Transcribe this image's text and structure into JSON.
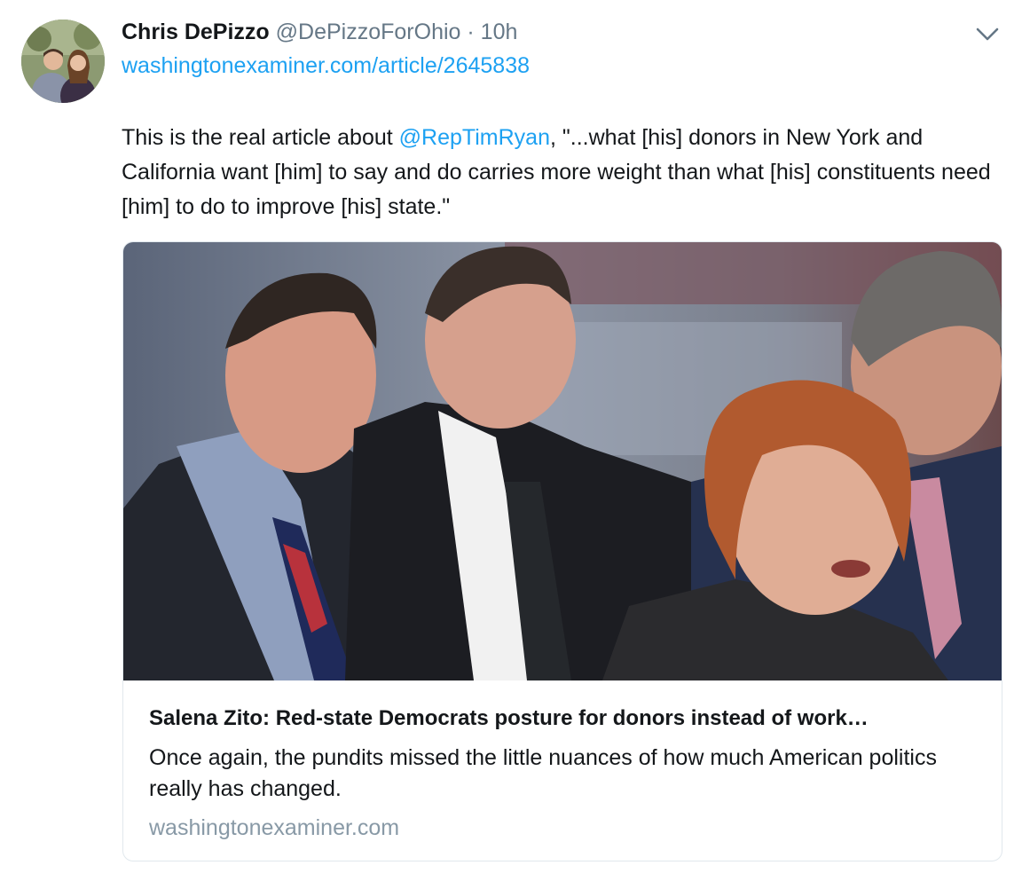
{
  "tweet": {
    "author_name": "Chris DePizzo",
    "author_handle": "@DePizzoForOhio",
    "separator": "·",
    "time": "10h",
    "link": "washingtonexaminer.com/article/2645838",
    "text_before": "This is the real article about ",
    "mention": "@RepTimRyan",
    "text_after": ", \"...what [his] donors in New York and California want [him] to say and do carries more weight than what [his] constituents need [him] to do to improve [his] state.\"",
    "menu_icon": "chevron-down-icon"
  },
  "card": {
    "title": "Salena Zito: Red-state Democrats posture for donors instead of work…",
    "description": "Once again, the pundits missed the little nuances of how much American politics really has changed.",
    "domain": "washingtonexaminer.com"
  },
  "colors": {
    "link": "#1da1f2",
    "secondary_text": "#657786",
    "domain_text": "#8899a6",
    "card_border": "#e1e8ed"
  }
}
